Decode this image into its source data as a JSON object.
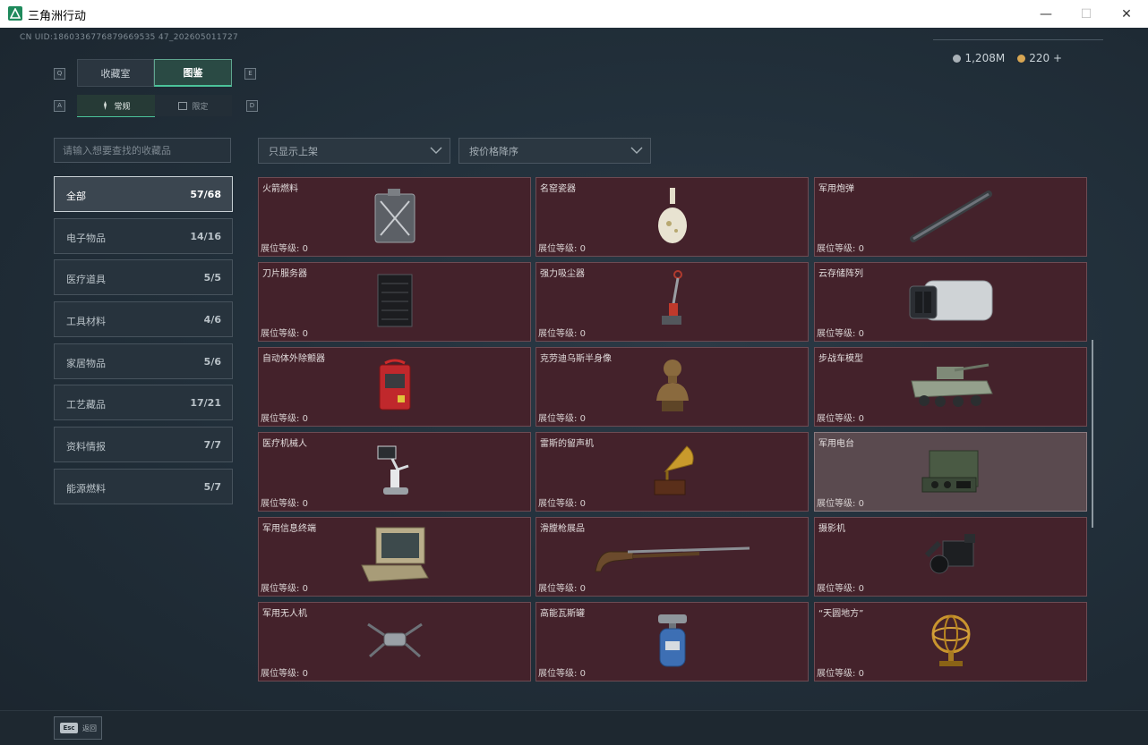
{
  "window": {
    "title": "三角洲行动",
    "minimize": "—",
    "maximize": "☐",
    "close": "✕"
  },
  "uid": "CN UID:1860336776879669535 47_202605011727",
  "currency": {
    "silver": "1,208M",
    "gold": "220",
    "add": "+"
  },
  "tabs": {
    "hint_left": "Q",
    "hint_right": "E",
    "collection": "收藏室",
    "catalog": "图鉴"
  },
  "subtabs": {
    "hint_left": "A",
    "hint_right": "D",
    "normal": "常规",
    "limited": "限定"
  },
  "search": {
    "placeholder": "请输入想要查找的收藏品"
  },
  "filters": {
    "shelf": "只显示上架",
    "sort": "按价格降序"
  },
  "categories": [
    {
      "name": "全部",
      "count": "57/68"
    },
    {
      "name": "电子物品",
      "count": "14/16"
    },
    {
      "name": "医疗道具",
      "count": "5/5"
    },
    {
      "name": "工具材料",
      "count": "4/6"
    },
    {
      "name": "家居物品",
      "count": "5/6"
    },
    {
      "name": "工艺藏品",
      "count": "17/21"
    },
    {
      "name": "资料情报",
      "count": "7/7"
    },
    {
      "name": "能源燃料",
      "count": "5/7"
    }
  ],
  "level_label": "展位等级:",
  "items": [
    {
      "name": "火箭燃料",
      "level": "0"
    },
    {
      "name": "名窑瓷器",
      "level": "0"
    },
    {
      "name": "军用炮弹",
      "level": "0"
    },
    {
      "name": "刀片服务器",
      "level": "0"
    },
    {
      "name": "强力吸尘器",
      "level": "0"
    },
    {
      "name": "云存储阵列",
      "level": "0"
    },
    {
      "name": "自动体外除颤器",
      "level": "0"
    },
    {
      "name": "克劳迪乌斯半身像",
      "level": "0"
    },
    {
      "name": "步战车模型",
      "level": "0"
    },
    {
      "name": "医疗机械人",
      "level": "0"
    },
    {
      "name": "雷斯的留声机",
      "level": "0"
    },
    {
      "name": "军用电台",
      "level": "0"
    },
    {
      "name": "军用信息终端",
      "level": "0"
    },
    {
      "name": "滑膛枪展品",
      "level": "0"
    },
    {
      "name": "摄影机",
      "level": "0"
    },
    {
      "name": "军用无人机",
      "level": "0"
    },
    {
      "name": "高能瓦斯罐",
      "level": "0"
    },
    {
      "name": "“天圆地方”",
      "level": "0"
    }
  ],
  "footer": {
    "key": "Esc",
    "label": "返回"
  }
}
